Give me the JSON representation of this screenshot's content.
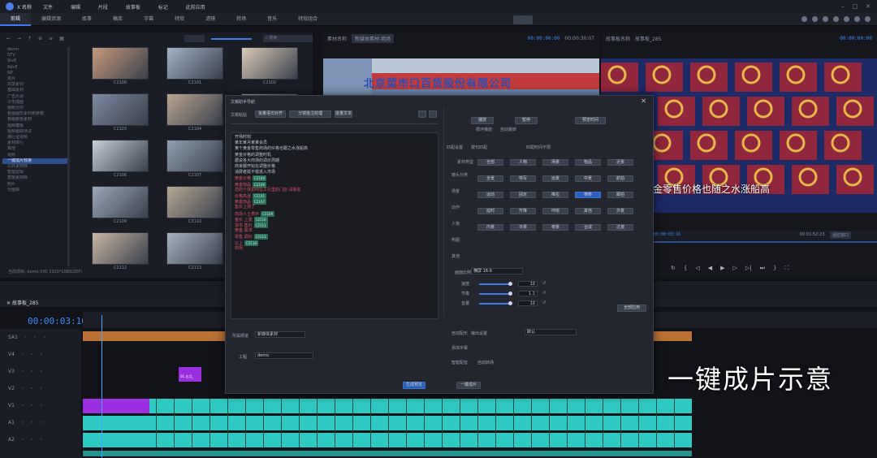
{
  "app": {
    "title": "X 名称",
    "menu": [
      "文件",
      "编辑",
      "片段",
      "故事板",
      "标记",
      "此前应用"
    ]
  },
  "tabs": [
    "剪辑",
    "编辑资源",
    "故事",
    "稿库",
    "字幕",
    "特效",
    "滤镜",
    "转场",
    "音乐",
    "特效组合"
  ],
  "left": {
    "search_placeholder": "搜索",
    "tree": [
      "demo",
      "STV",
      "StvE",
      "AdvE",
      "NP",
      "单片",
      "共享素材",
      "基础素材",
      "广告片源",
      "子形成面",
      "视频分中",
      "各版图形素材和参数",
      "各版颜色素材",
      "视频模板",
      "视频跟踪测试",
      "通行证视频",
      "素材库行",
      "其他",
      "视频",
      "一键成片效果",
      "公共素材库",
      "智能剪辑",
      "智能素材库",
      "照片",
      "分图库"
    ],
    "thumbs": [
      "C2100",
      "C2101",
      "C2102",
      "C2103",
      "C2104",
      "C2105",
      "C2106",
      "C2107",
      "C2108",
      "C2109",
      "C2110",
      "C2111",
      "C2112",
      "C2113",
      "C2114"
    ],
    "status": "当前项目: demo (HD 1920*1080/25P)"
  },
  "preview_left": {
    "label": "素材名称",
    "clip": "新媒体素材-商场",
    "time": "00:00:00:00",
    "dur": "00:00:30:07",
    "sign": "北京菜市口百货股份有限公司"
  },
  "preview_right": {
    "label": "故事板名称",
    "clip": "故事板_285",
    "time": "00:00:00:00",
    "subtitle": "黄金零售价格也随之水涨船高",
    "pos": "00:00:03:16",
    "total": "00:01:52:23",
    "zoom": "适应窗口"
  },
  "dialog": {
    "title": "文稿助手导航",
    "textsel": "文稿粘贴",
    "btns": [
      "批量语句对齐",
      "分镜批注处理",
      "批量文本"
    ],
    "right_top": [
      "播放",
      "暂停",
      "预览时间"
    ],
    "ck1": "循环播放",
    "ck2": "自动跳转",
    "sec1": "匹配设置",
    "opt1": "按句匹配",
    "opt2": "匹配时间不限",
    "sec2": "素材类型",
    "cat_labels": [
      "镜头分类",
      "场景",
      "动作",
      "人物",
      "构图",
      "其他"
    ],
    "cats": [
      "全部",
      "人物",
      "场景",
      "物品",
      "近景",
      "全景",
      "特写",
      "远景",
      "中景",
      "航拍",
      "运动",
      "固定",
      "推拉",
      "横移",
      "跟拍",
      "延时",
      "升降",
      "环绕",
      "其他",
      "外景",
      "内景",
      "日景",
      "夜景",
      "合成",
      "过渡"
    ],
    "sec3": "画面比例",
    "ratio": "横屏 16:9",
    "params": [
      {
        "label": "速度",
        "value": "10"
      },
      {
        "label": "节奏",
        "value": "1.1"
      },
      {
        "label": "音量",
        "value": "10"
      }
    ],
    "apply": "全部应用",
    "lines": [
      {
        "t": "开场时刻",
        "red": false,
        "tag": ""
      },
      {
        "t": "某年某月某某会员",
        "red": false,
        "tag": ""
      },
      {
        "t": "某个黄金零售商场的价格也跟之水涨船高",
        "red": false,
        "tag": ""
      },
      {
        "t": "黄金价格的调整时机",
        "red": false,
        "tag": ""
      },
      {
        "t": "据说各大商场的调价周期",
        "red": false,
        "tag": ""
      },
      {
        "t": "商家都开始在调整价格",
        "red": false,
        "tag": ""
      },
      {
        "t": "消费者挺不错进入市场",
        "red": false,
        "tag": ""
      },
      {
        "t": "黄金价格",
        "red": true,
        "tag": "C2104"
      },
      {
        "t": "黄金饰品",
        "red": true,
        "tag": "C2106"
      },
      {
        "t": "您的个体如何在工行里的门店 请除名",
        "red": true,
        "tag": ""
      },
      {
        "t": "价格高涨",
        "red": true,
        "tag": "C2101"
      },
      {
        "t": "黄金饰品",
        "red": true,
        "tag": "C2107"
      },
      {
        "t": "售价上涨了",
        "red": true,
        "tag": ""
      },
      {
        "t": "商场人士表示",
        "red": true,
        "tag": "C2109"
      },
      {
        "t": "金价 上涨",
        "red": true,
        "tag": "C2110"
      },
      {
        "t": "货币 售价",
        "red": true,
        "tag": "C2111"
      },
      {
        "t": "黄金 需求",
        "red": true,
        "tag": ""
      },
      {
        "t": "零售 调价",
        "red": true,
        "tag": "C2113"
      },
      {
        "t": "以上",
        "red": true,
        "tag": "C2114"
      },
      {
        "t": "商场",
        "red": true,
        "tag": ""
      }
    ],
    "bottom": {
      "sel_label": "所属频道",
      "sel": "新媒体素材",
      "proj_label": "工程",
      "proj": "demo",
      "target": "输出设置",
      "target_val": "默认",
      "ok": "生成预览",
      "cancel": "一键成片",
      "cks": [
        "自动配乐",
        "添加字幕",
        "智能配音",
        "自动转场"
      ]
    }
  },
  "timeline": {
    "seq": "故事板_285",
    "timecode": "00:00:03:16",
    "tracks": [
      {
        "n": "SA1"
      },
      {
        "n": "V4"
      },
      {
        "n": "V3"
      },
      {
        "n": "V2"
      },
      {
        "n": "V1"
      },
      {
        "n": "A1"
      },
      {
        "n": "A2"
      }
    ],
    "v3clip": "01.五月_",
    "caption": "一键成片示意"
  },
  "colors": {
    "accent": "#3d7cf0",
    "video": "#2ec9c2",
    "purple": "#9b2fe0",
    "orange": "#d9823a"
  }
}
